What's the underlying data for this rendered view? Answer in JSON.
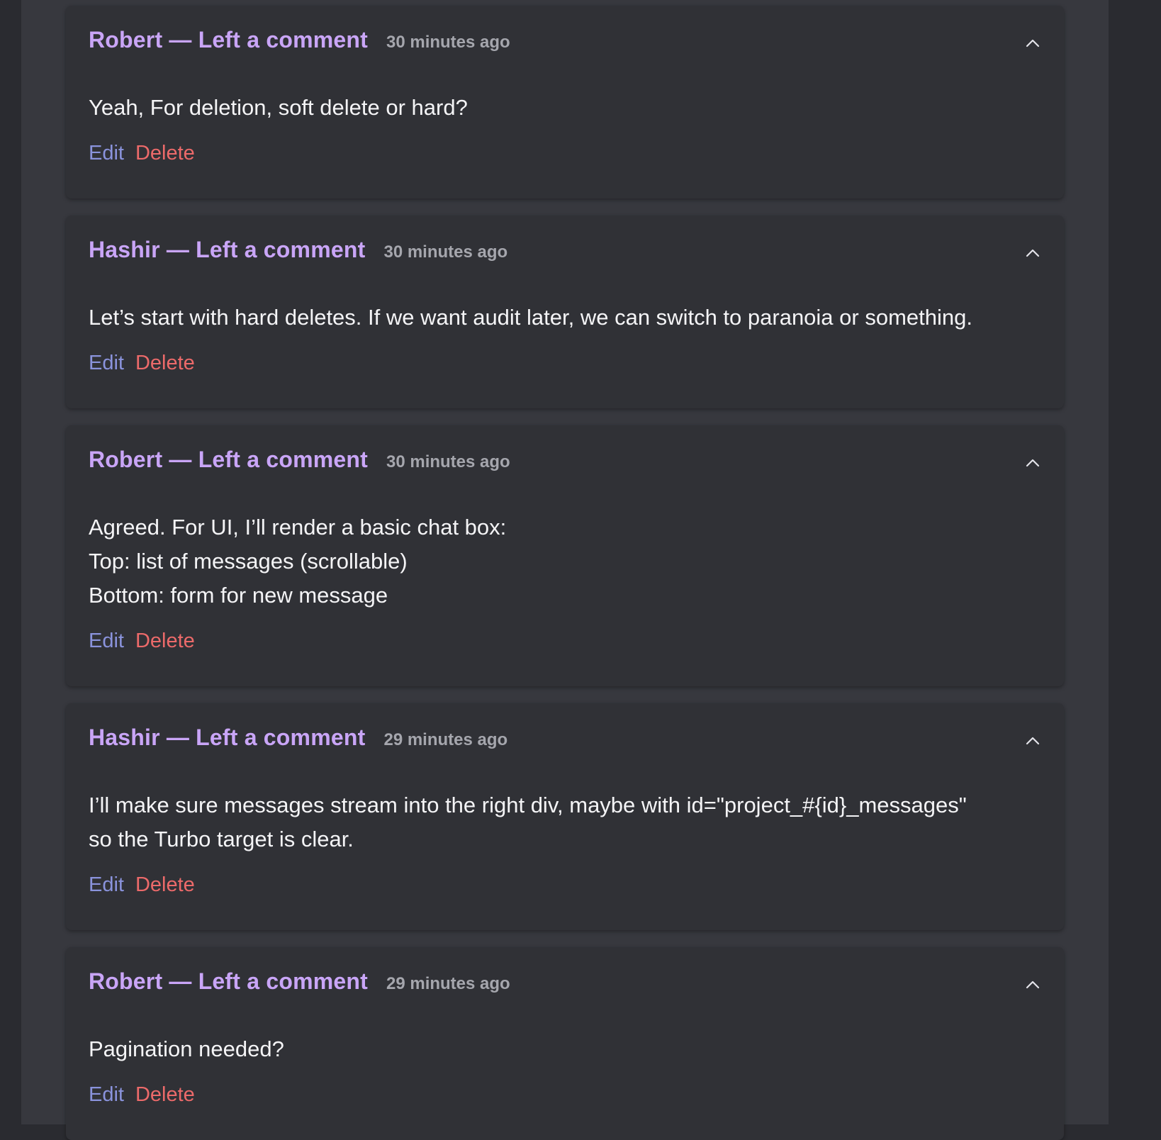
{
  "colors": {
    "title": "#c9a5f7",
    "timestamp": "#a5a6ad",
    "body": "#f4f4f6",
    "edit": "#8a93dc",
    "delete": "#ec6a6a",
    "card_bg": "#303136",
    "page_bg": "#37383e"
  },
  "comments": [
    {
      "title": "Robert — Left a comment",
      "timestamp": "30 minutes ago",
      "lines": [
        "Yeah, For deletion, soft delete or hard?"
      ],
      "edit_label": "Edit",
      "delete_label": "Delete",
      "toggle_icon": "chevron-up-icon"
    },
    {
      "title": "Hashir — Left a comment",
      "timestamp": "30 minutes ago",
      "lines": [
        "Let’s start with hard deletes. If we want audit later, we can switch to paranoia or something."
      ],
      "edit_label": "Edit",
      "delete_label": "Delete",
      "toggle_icon": "chevron-up-icon"
    },
    {
      "title": "Robert — Left a comment",
      "timestamp": "30 minutes ago",
      "lines": [
        "Agreed. For UI, I’ll render a basic chat box:",
        "Top: list of messages (scrollable)",
        "Bottom: form for new message"
      ],
      "edit_label": "Edit",
      "delete_label": "Delete",
      "toggle_icon": "chevron-up-icon"
    },
    {
      "title": "Hashir — Left a comment",
      "timestamp": "29 minutes ago",
      "lines": [
        "I’ll make sure messages stream into the right div, maybe with id=\"project_#{id}_messages\"",
        "so the Turbo target is clear."
      ],
      "edit_label": "Edit",
      "delete_label": "Delete",
      "toggle_icon": "chevron-up-icon"
    },
    {
      "title": "Robert — Left a comment",
      "timestamp": "29 minutes ago",
      "lines": [
        "Pagination needed?"
      ],
      "edit_label": "Edit",
      "delete_label": "Delete",
      "toggle_icon": "chevron-up-icon"
    }
  ]
}
